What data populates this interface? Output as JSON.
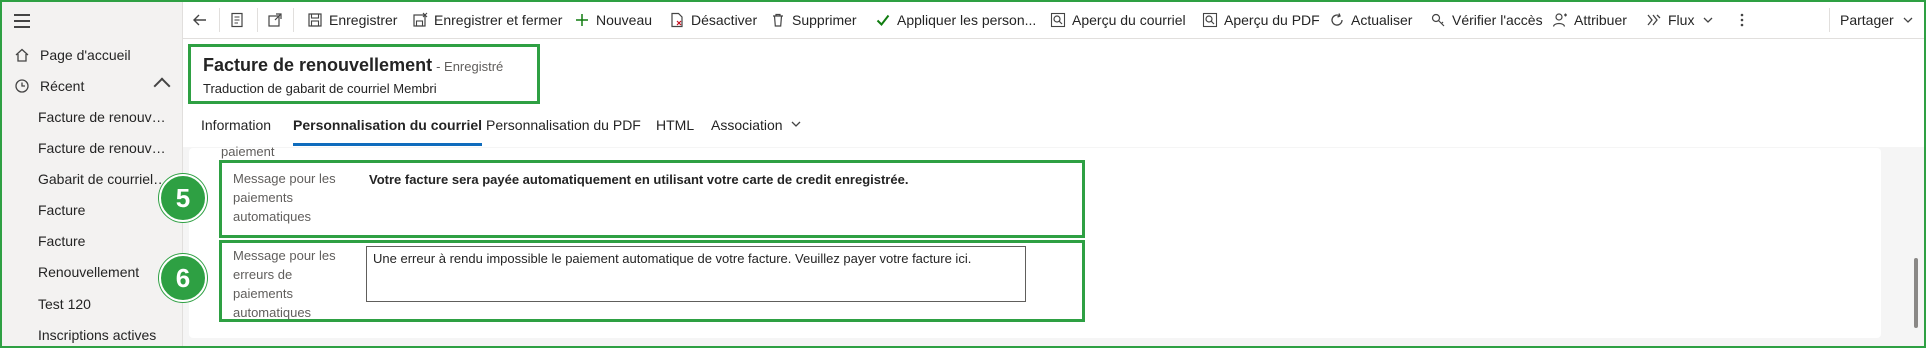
{
  "nav": {
    "home": "Page d'accueil",
    "recent": "Récent",
    "recent_items": [
      "Facture de renouvell...",
      "Facture de renouvell...",
      "Gabarit de courriels ...",
      "Facture",
      "Facture",
      "Renouvellement",
      "Test 120",
      "Inscriptions actives"
    ]
  },
  "toolbar": {
    "save": "Enregistrer",
    "save_close": "Enregistrer et fermer",
    "new": "Nouveau",
    "deactivate": "Désactiver",
    "delete": "Supprimer",
    "apply": "Appliquer les person...",
    "preview_email": "Aperçu du courriel",
    "preview_pdf": "Aperçu du PDF",
    "refresh": "Actualiser",
    "check_access": "Vérifier l'accès",
    "assign": "Attribuer",
    "flow": "Flux",
    "share": "Partager"
  },
  "header": {
    "title": "Facture de renouvellement",
    "status": "- Enregistré",
    "subtitle": "Traduction de gabarit de courriel Membri"
  },
  "tabs": [
    "Information",
    "Personnalisation du courriel",
    "Personnalisation du PDF",
    "HTML",
    "Association"
  ],
  "form": {
    "partial_label": "paiement",
    "auto_payment_label": [
      "Message pour les",
      "paiements",
      "automatiques"
    ],
    "auto_payment_value": "Votre facture sera payée automatiquement en utilisant votre carte de credit enregistrée.",
    "error_label": [
      "Message pour les",
      "erreurs de",
      "paiements",
      "automatiques"
    ],
    "error_value": "Une erreur à rendu impossible le paiement automatique de votre facture. Veuillez payer votre facture ici."
  },
  "badges": {
    "five": "5",
    "six": "6"
  },
  "colors": {
    "highlight": "#2ea043",
    "accent": "#0f6cbd",
    "check": "#107c10"
  }
}
